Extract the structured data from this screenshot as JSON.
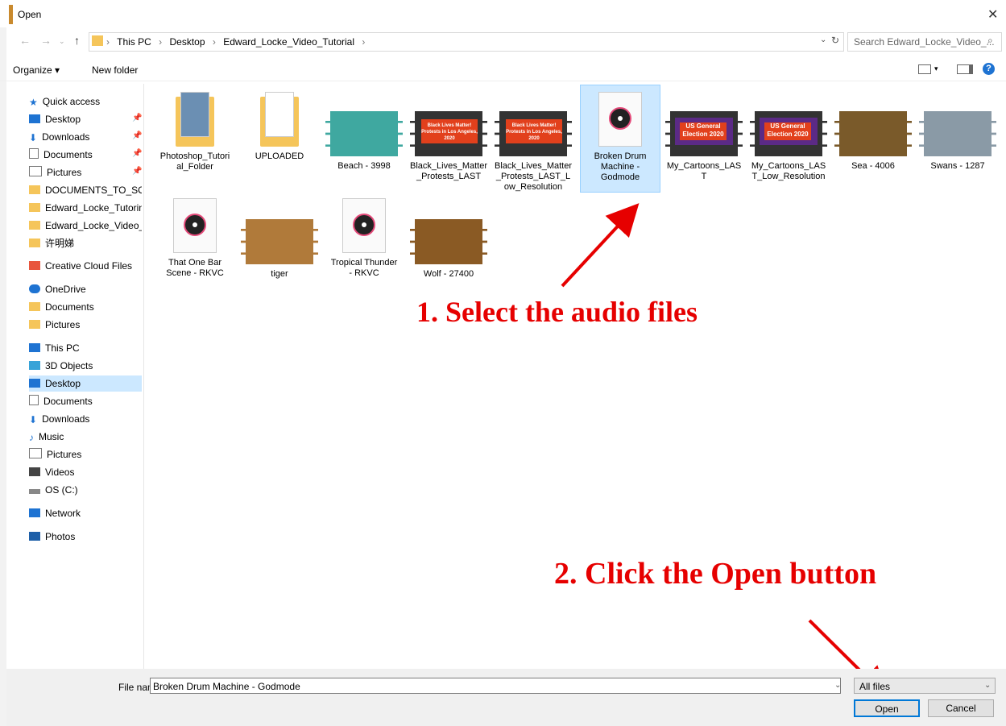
{
  "window": {
    "title": "Open"
  },
  "address": {
    "crumbs": [
      "This PC",
      "Desktop",
      "Edward_Locke_Video_Tutorial"
    ],
    "search_placeholder": "Search Edward_Locke_Video_..."
  },
  "toolbar": {
    "organize": "Organize ▾",
    "new_folder": "New folder"
  },
  "nav": {
    "quick_access": "Quick access",
    "quick_items": [
      "Desktop",
      "Downloads",
      "Documents",
      "Pictures",
      "DOCUMENTS_TO_SORT",
      "Edward_Locke_Tutoring",
      "Edward_Locke_Video_Tu",
      "许明娣"
    ],
    "creative_cloud": "Creative Cloud Files",
    "onedrive": "OneDrive",
    "onedrive_items": [
      "Documents",
      "Pictures"
    ],
    "this_pc": "This PC",
    "pc_items": [
      "3D Objects",
      "Desktop",
      "Documents",
      "Downloads",
      "Music",
      "Pictures",
      "Videos",
      "OS (C:)"
    ],
    "network": "Network",
    "photos": "Photos"
  },
  "files": [
    {
      "name": "Photoshop_Tutorial_Folder",
      "kind": "folder"
    },
    {
      "name": "UPLOADED",
      "kind": "folder"
    },
    {
      "name": "Beach - 3998",
      "kind": "video"
    },
    {
      "name": "Black_Lives_Matter_Protests_LAST",
      "kind": "video"
    },
    {
      "name": "Black_Lives_Matter_Protests_LAST_Low_Resolution",
      "kind": "video"
    },
    {
      "name": "Broken Drum Machine - Godmode",
      "kind": "audio",
      "selected": true
    },
    {
      "name": "My_Cartoons_LAST",
      "kind": "video"
    },
    {
      "name": "My_Cartoons_LAST_Low_Resolution",
      "kind": "video"
    },
    {
      "name": "Sea - 4006",
      "kind": "video"
    },
    {
      "name": "Swans - 1287",
      "kind": "video"
    },
    {
      "name": "That One Bar Scene - RKVC",
      "kind": "audio"
    },
    {
      "name": "tiger",
      "kind": "video"
    },
    {
      "name": "Tropical Thunder - RKVC",
      "kind": "audio"
    },
    {
      "name": "Wolf - 27400",
      "kind": "video"
    }
  ],
  "thumb_text": {
    "blm": "Black Lives Matter! Protests in Los Angeles, 2020",
    "us": "US General Election 2020"
  },
  "annotations": {
    "step1": "1. Select the audio files",
    "step2": "2. Click the Open button"
  },
  "bottom": {
    "file_name_label": "File name:",
    "file_name_value": "Broken Drum Machine - Godmode",
    "file_type": "All files",
    "open": "Open",
    "cancel": "Cancel"
  }
}
